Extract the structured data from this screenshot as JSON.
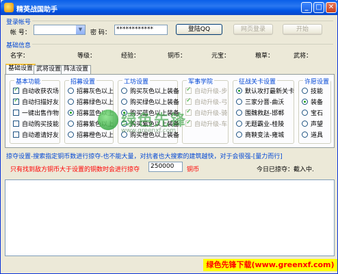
{
  "window": {
    "title": "精英战国助手",
    "min": "_",
    "max": "□",
    "close": "✕"
  },
  "login": {
    "group": "登录帐号",
    "account_label": "帐  号：",
    "account_value": "",
    "password_label": "密  码：",
    "password_value": "************",
    "login_btn": "登陆QQ",
    "web_login_btn": "网页登录",
    "start_btn": "开始"
  },
  "basic_info": {
    "group": "基础信息",
    "fields": [
      "名字：",
      "等级：",
      "经验：",
      "铜币：",
      "元宝：",
      "粮草：",
      "武将："
    ]
  },
  "tabs": [
    "基础设置",
    "武将设置",
    "阵法设置"
  ],
  "basic_functions": {
    "title": "基本功能",
    "items": [
      {
        "label": "自动收获农场",
        "checked": true
      },
      {
        "label": "自动扫描好友",
        "checked": true
      },
      {
        "label": "一键出售作物",
        "checked": false
      },
      {
        "label": "自动购买技能",
        "checked": false
      },
      {
        "label": "自动邀请好友",
        "checked": false
      }
    ]
  },
  "recruit": {
    "title": "招募设置",
    "items": [
      {
        "label": "招募灰色以上",
        "checked": false
      },
      {
        "label": "招募绿色以上",
        "checked": false
      },
      {
        "label": "招募蓝色以上",
        "checked": true
      },
      {
        "label": "招募紫色以上",
        "checked": false
      },
      {
        "label": "招募橙色以上",
        "checked": false
      }
    ]
  },
  "craft": {
    "title": "工坊设置",
    "items": [
      {
        "label": "购买灰色以上装备",
        "checked": false
      },
      {
        "label": "购买绿色以上装备",
        "checked": false
      },
      {
        "label": "购买蓝色以上装备",
        "checked": true
      },
      {
        "label": "购买紫色以上装备",
        "checked": false
      },
      {
        "label": "购买橙色以上装备",
        "checked": false
      }
    ]
  },
  "military": {
    "title": "军事学院",
    "items": [
      {
        "label": "自动升级-步",
        "checked": true
      },
      {
        "label": "自动升级-弓",
        "checked": true
      },
      {
        "label": "自动升级-骑",
        "checked": true
      },
      {
        "label": "自动升级-车",
        "checked": true
      }
    ]
  },
  "campaign": {
    "title": "征战关卡设置",
    "items": [
      {
        "label": "默认攻打最新关卡",
        "checked": true
      },
      {
        "label": "三家分晋-曲沃",
        "checked": false
      },
      {
        "label": "围魏救赵-邯郸",
        "checked": false
      },
      {
        "label": "无题霸业-桂陵",
        "checked": false
      },
      {
        "label": "商鞅变法-雍城",
        "checked": false
      }
    ]
  },
  "favorite": {
    "title": "许愿设置",
    "items": [
      {
        "label": "技能",
        "checked": false
      },
      {
        "label": "装备",
        "checked": true
      },
      {
        "label": "宝石",
        "checked": false
      },
      {
        "label": "声望",
        "checked": false
      },
      {
        "label": "道具",
        "checked": false
      }
    ]
  },
  "plunder": {
    "group": "掠夺设置-搜索指定铜币数进行掠夺-也不能大量，对抗者也大搜索的建筑越快，对于会很强-[量力而行]",
    "rule_text": "只有找到敌方铜币大于设置的铜数时会进行掠夺",
    "amount": "250000",
    "unit": "铜币",
    "today": "今日已掠夺：截入中."
  },
  "watermark": {
    "text": "绿色先锋",
    "url": "www.greenxf.com"
  },
  "banner": "绿色先锋下载(www.greenxf.com)",
  "colors": {
    "titlebar": "#0a5fe8",
    "group_title": "#0046d5",
    "warning": "#ff0000",
    "banner_bg": "#ffff00"
  }
}
